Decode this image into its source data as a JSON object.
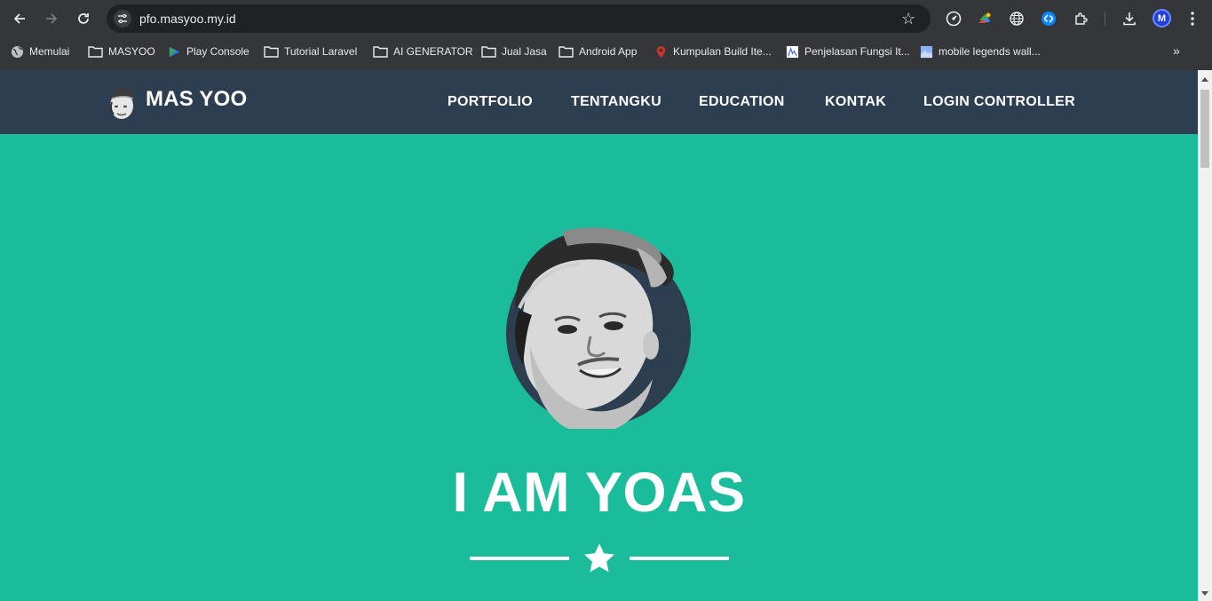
{
  "browser": {
    "url": "pfo.masyoo.my.id",
    "profile_initial": "M",
    "bookmarks": [
      {
        "label": "Memulai",
        "icon": "globe-icon"
      },
      {
        "label": "MASYOO",
        "icon": "folder-icon"
      },
      {
        "label": "Play Console",
        "icon": "play-console-icon"
      },
      {
        "label": "Tutorial Laravel",
        "icon": "folder-icon"
      },
      {
        "label": "AI GENERATOR",
        "icon": "folder-icon"
      },
      {
        "label": "Jual Jasa",
        "icon": "folder-icon"
      },
      {
        "label": "Android App",
        "icon": "folder-icon"
      },
      {
        "label": "Kumpulan Build Ite...",
        "icon": "site-favicon-icon"
      },
      {
        "label": "Penjelasan Fungsi It...",
        "icon": "site-favicon-icon"
      },
      {
        "label": "mobile legends wall...",
        "icon": "image-favicon-icon"
      }
    ]
  },
  "site": {
    "brand": "MAS YOO",
    "nav": [
      "PORTFOLIO",
      "TENTANGKU",
      "EDUCATION",
      "KONTAK",
      "LOGIN CONTROLLER"
    ],
    "hero_title": "I AM YOAS"
  },
  "colors": {
    "hero_bg": "#1abc9c",
    "navbar_bg": "#2c3e50",
    "avatar_circle": "#2c3e50"
  }
}
